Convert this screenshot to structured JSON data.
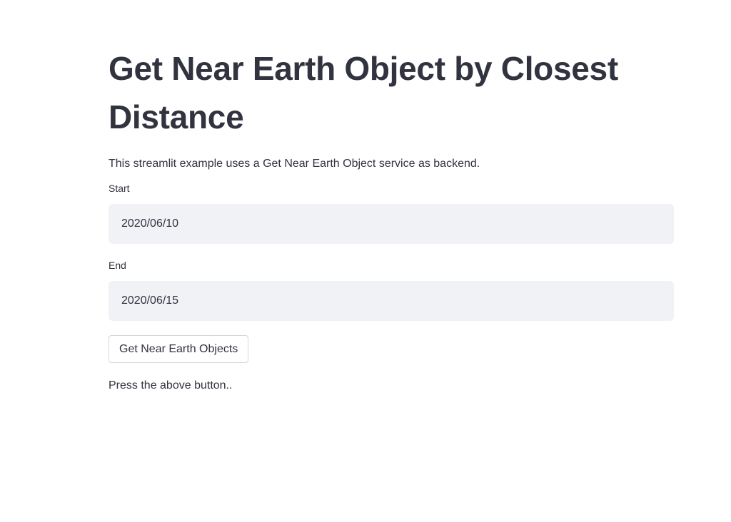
{
  "page": {
    "title": "Get Near Earth Object by Closest Distance",
    "description": "This streamlit example uses a Get Near Earth Object service as backend."
  },
  "form": {
    "start": {
      "label": "Start",
      "value": "2020/06/10"
    },
    "end": {
      "label": "End",
      "value": "2020/06/15"
    },
    "submit_label": "Get Near Earth Objects"
  },
  "status": {
    "message": "Press the above button.."
  }
}
